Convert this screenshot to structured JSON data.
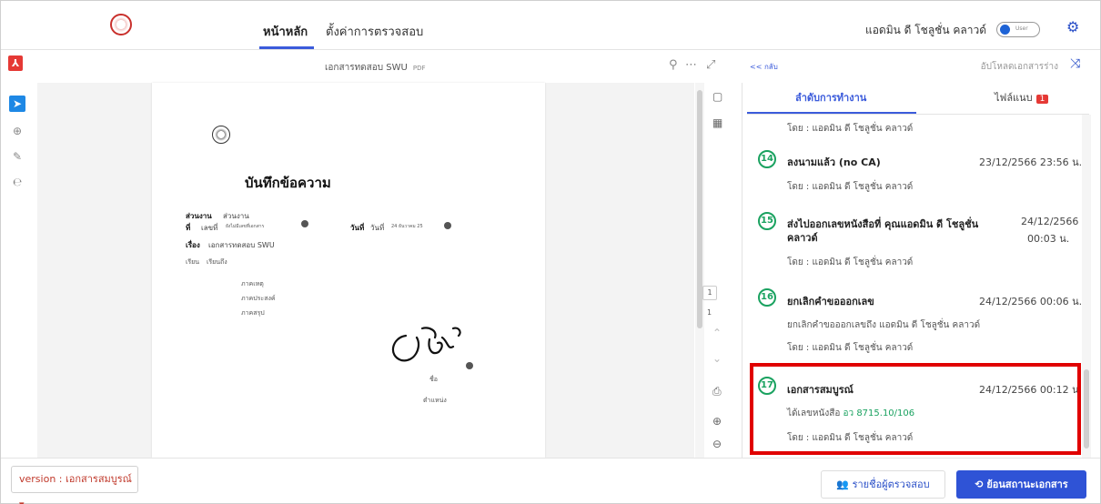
{
  "header": {
    "nav": [
      "หน้าหลัก",
      "ตั้งค่าการตรวจสอบ"
    ],
    "user_name": "แอดมิน ดี โชลูชั่น คลาวด์",
    "toggle_label": "User",
    "icons": {
      "logo": "university-seal-logo",
      "settings": "gear-icon"
    }
  },
  "viewer": {
    "title": "เอกสารทดสอบ SWU",
    "file_type": "PDF",
    "page_current": "1",
    "page_total": "1",
    "icons": [
      "pdf-icon",
      "search-icon",
      "more-icon",
      "expand-icon"
    ]
  },
  "memo": {
    "heading": "บันทึกข้อความ",
    "dept_label": "ส่วนงาน",
    "dept_value": "ส่วนงาน",
    "no_label": "ที่",
    "no_value": "เลขที่",
    "no_small": "ยังไม่มีเลขที่เอกสาร",
    "date_label": "วันที่",
    "date_value": "วันที่",
    "date_small": "24 ธันวาคม 25",
    "subject_label": "เรื่อง",
    "subject_value": "เอกสารทดสอบ SWU",
    "to_label": "เรียน",
    "to_value": "เรียนถึง",
    "items": [
      "ภาคเหตุ",
      "ภาคประสงค์",
      "ภาคสรุป"
    ],
    "sign_name": "ชื่อ",
    "sign_position": "ตำแหน่ง"
  },
  "panel": {
    "back": "<< กลับ",
    "upload": "อัปโหลดเอกสารร่าง",
    "tabs": [
      {
        "label": "ลำดับการทำงาน"
      },
      {
        "label": "ไฟล์แนบ",
        "badge": "1"
      }
    ],
    "top_by": "โดย : แอดมิน ดี โชลูชั่น คลาวด์",
    "steps": [
      {
        "num": "14",
        "title": "ลงนามแล้ว (no CA)",
        "time": "23/12/2566 23:56 น.",
        "by": "โดย : แอดมิน ดี โชลูชั่น คลาวด์"
      },
      {
        "num": "15",
        "title": "ส่งไปออกเลขหนังสือที่ คุณแอดมิน ดี โชลูชั่น",
        "title2": "คลาวด์",
        "time": "24/12/2566",
        "time2": "00:03 น.",
        "by": "โดย : แอดมิน ดี โชลูชั่น คลาวด์"
      },
      {
        "num": "16",
        "title": "ยกเลิกคำขอออกเลข",
        "time": "24/12/2566 00:06 น.",
        "detail": "ยกเลิกคำขอออกเลขถึง แอดมิน ดี โชลูชั่น คลาวด์",
        "by": "โดย : แอดมิน ดี โชลูชั่น คลาวด์"
      },
      {
        "num": "17",
        "title": "เอกสารสมบูรณ์",
        "time": "24/12/2566 00:12 น.",
        "detail_prefix": "ได้เลขหนังสือ",
        "detail_number": "อว 8715.10/106",
        "by": "โดย : แอดมิน ดี โชลูชั่น คลาวด์"
      }
    ]
  },
  "footer": {
    "version": "version : เอกสารสมบูรณ์ ▾",
    "reviewers_button": "รายชื่อผู้ตรวจสอบ",
    "revert_button": "ย้อนสถานะเอกสาร"
  },
  "colors": {
    "accent": "#2f53d6",
    "success": "#1aa260",
    "alert": "#e00000",
    "pdf": "#e53935"
  }
}
